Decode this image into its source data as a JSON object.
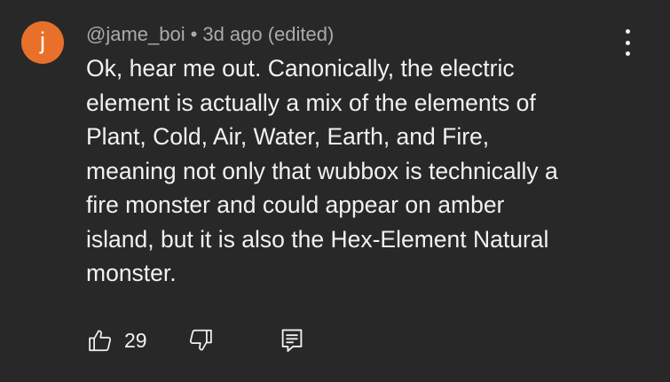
{
  "comment": {
    "avatar_letter": "j",
    "avatar_color": "#e8702a",
    "author": "@jame_boi",
    "separator": "•",
    "time": "3d ago (edited)",
    "text_lines": [
      "Ok, hear me out. Canonically, the electric",
      "element is actually a mix of the elements of",
      "Plant, Cold, Air, Water, Earth, and Fire,",
      "meaning not only that wubbox is technically a",
      "fire monster and could appear on amber",
      "island, but it is also the Hex-Element Natural",
      "monster."
    ],
    "like_count": "29",
    "icons": {
      "like": "thumbs-up-icon",
      "dislike": "thumbs-down-icon",
      "reply": "reply-icon",
      "more": "more-vertical-icon"
    }
  }
}
